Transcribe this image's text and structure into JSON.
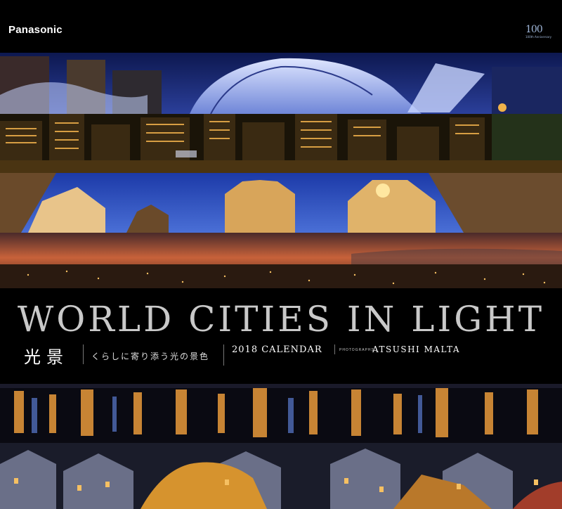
{
  "brand": {
    "logo_text": "Panasonic",
    "anniversary_number": "100",
    "anniversary_label": "100th Anniversary"
  },
  "title": {
    "main": "WORLD CITIES IN LIGHT",
    "kanji": "光景",
    "tagline": "くらしに寄り添う光の景色",
    "calendar_year": "2018 CALENDAR",
    "photographs_label": "PHOTOGRAPHS",
    "photographer": "ATSUSHI MALTA"
  },
  "colors": {
    "background": "#000000",
    "night_sky": "#1b2a6a",
    "city_light": "#f2a53a",
    "title_text": "#c9c9c9"
  }
}
